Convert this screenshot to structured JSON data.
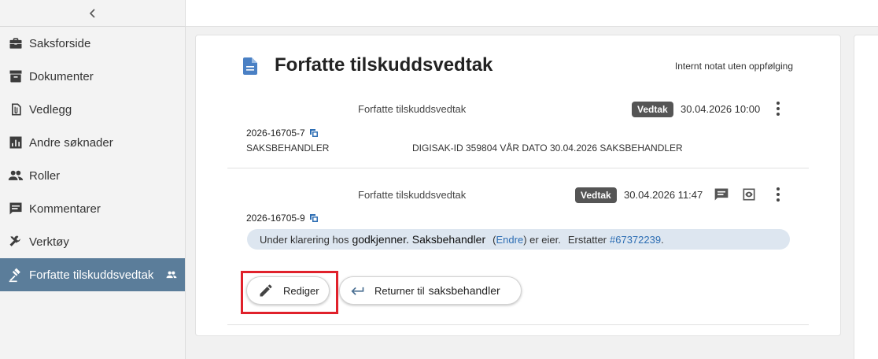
{
  "sidebar": {
    "items": [
      {
        "label": "Saksforside",
        "icon": "briefcase-icon"
      },
      {
        "label": "Dokumenter",
        "icon": "archive-icon"
      },
      {
        "label": "Vedlegg",
        "icon": "paperclip-icon"
      },
      {
        "label": "Andre søknader",
        "icon": "bar-chart-icon"
      },
      {
        "label": "Roller",
        "icon": "people-icon"
      },
      {
        "label": "Kommentarer",
        "icon": "comment-icon"
      },
      {
        "label": "Verktøy",
        "icon": "tools-icon"
      },
      {
        "label": "Forfatte tilskuddsvedtak",
        "icon": "gavel-icon",
        "active": true
      }
    ]
  },
  "card": {
    "title": "Forfatte tilskuddsvedtak",
    "note": "Internt notat uten oppfølging"
  },
  "documents": [
    {
      "title": "Forfatte tilskuddsvedtak",
      "badge": "Vedtak",
      "date": "30.04.2026 10:00",
      "ref": "2026-16705-7",
      "meta_left": "SAKSBEHANDLER",
      "meta_right": "DIGISAK-ID 359804 VÅR DATO 30.04.2026   SAKSBEHANDLER"
    },
    {
      "title": "Forfatte tilskuddsvedtak",
      "badge": "Vedtak",
      "date": "30.04.2026 11:47",
      "ref": "2026-16705-9"
    }
  ],
  "status": {
    "prefix": "Under klarering hos",
    "approver": "godkjenner. Saksbehandler",
    "paren_open": "(",
    "change_link": "Endre",
    "paren_close": ") er eier.",
    "replaces_label": "Erstatter",
    "replaces_link": "#67372239",
    "period": "."
  },
  "actions": {
    "edit_label": "Rediger",
    "return_label": "Returner til",
    "return_target": "saksbehandler"
  },
  "colors": {
    "active_nav": "#5b7d9a",
    "accent_blue": "#2c6db3",
    "highlight_red": "#e0212b",
    "status_bg": "#dde6f0"
  }
}
